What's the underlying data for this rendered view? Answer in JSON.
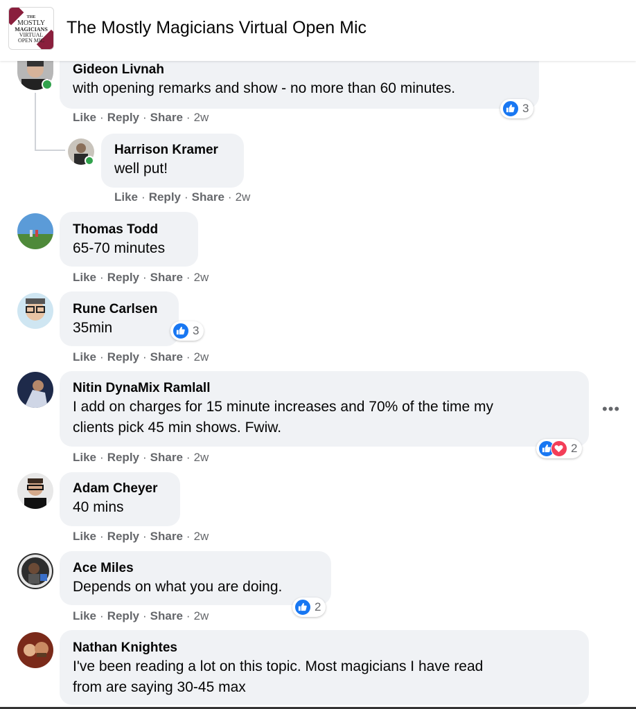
{
  "header": {
    "title": "The Mostly Magicians Virtual Open Mic",
    "logo_lines": [
      "THE",
      "MOSTLY",
      "MAGICIANS",
      "VIRTUAL",
      "OPEN MIC"
    ]
  },
  "actions": {
    "like": "Like",
    "reply": "Reply",
    "share": "Share",
    "sep": "·"
  },
  "icons": {
    "like": "thumbs-up-icon",
    "love": "heart-icon",
    "more": "more-options-icon"
  },
  "colors": {
    "like_blue": "#1877f2",
    "love_red": "#f33e58",
    "online_green": "#31a24c",
    "bubble_bg": "#f0f2f5",
    "meta_gray": "#65676b"
  },
  "comments": [
    {
      "name": "Gideon Livnah",
      "lines": [
        "with opening remarks and show - no more than 60 minutes."
      ],
      "time": "2w",
      "reaction_count": "3",
      "online": true
    },
    {
      "name": "Harrison Kramer",
      "lines": [
        "well put!"
      ],
      "time": "2w",
      "online": true,
      "is_reply": true
    },
    {
      "name": "Thomas Todd",
      "lines": [
        "65-70 minutes"
      ],
      "time": "2w"
    },
    {
      "name": "Rune Carlsen",
      "lines": [
        "35min"
      ],
      "time": "2w",
      "reaction_count": "3"
    },
    {
      "name": "Nitin DynaMix Ramlall",
      "lines": [
        "I add on charges for 15 minute increases and 70% of the time my",
        "clients pick 45 min shows. Fwiw."
      ],
      "time": "2w",
      "reaction_count": "2",
      "more": "•••"
    },
    {
      "name": "Adam Cheyer",
      "lines": [
        "40 mins"
      ],
      "time": "2w"
    },
    {
      "name": "Ace Miles",
      "lines": [
        "Depends on what you are doing."
      ],
      "time": "2w",
      "reaction_count": "2"
    },
    {
      "name": "Nathan Knightes",
      "lines": [
        "I've been reading a lot on this topic. Most magicians I have read",
        "from are saying 30-45 max"
      ]
    }
  ]
}
